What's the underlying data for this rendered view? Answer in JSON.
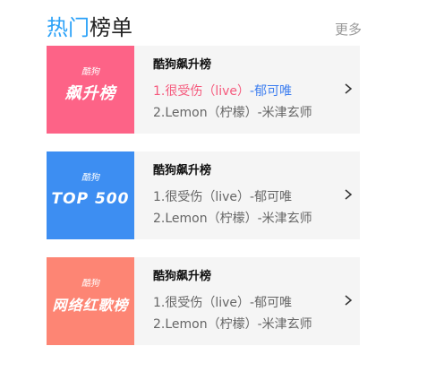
{
  "header": {
    "title_highlight": "热门",
    "title_rest": "榜单",
    "more_label": "更多"
  },
  "charts": [
    {
      "cover_brand": "酷狗",
      "cover_title": "飙升榜",
      "name": "酷狗飙升榜",
      "songs": [
        {
          "title": "1.很受伤（live）",
          "artist": "-郁可唯"
        },
        {
          "title": "2.Lemon（柠檬）",
          "artist": "-米津玄师"
        }
      ]
    },
    {
      "cover_brand": "酷狗",
      "cover_title": "TOP 500",
      "name": "酷狗飙升榜",
      "songs": [
        {
          "title": "1.很受伤（live）",
          "artist": "-郁可唯"
        },
        {
          "title": "2.Lemon（柠檬）",
          "artist": "-米津玄师"
        }
      ]
    },
    {
      "cover_brand": "酷狗",
      "cover_title": "网络红歌榜",
      "name": "酷狗飙升榜",
      "songs": [
        {
          "title": "1.很受伤（live）",
          "artist": "-郁可唯"
        },
        {
          "title": "2.Lemon（柠檬）",
          "artist": "-米津玄师"
        }
      ]
    }
  ],
  "colors": {
    "accent_blue": "#2ca2f8",
    "cover_pink": "#fd6387",
    "cover_blue": "#3d8ef2",
    "cover_coral": "#fd8574",
    "active_song_title": "#f55a7d",
    "active_song_artist": "#3d7ef0"
  },
  "icons": {
    "expand": "chevron-right-icon"
  }
}
